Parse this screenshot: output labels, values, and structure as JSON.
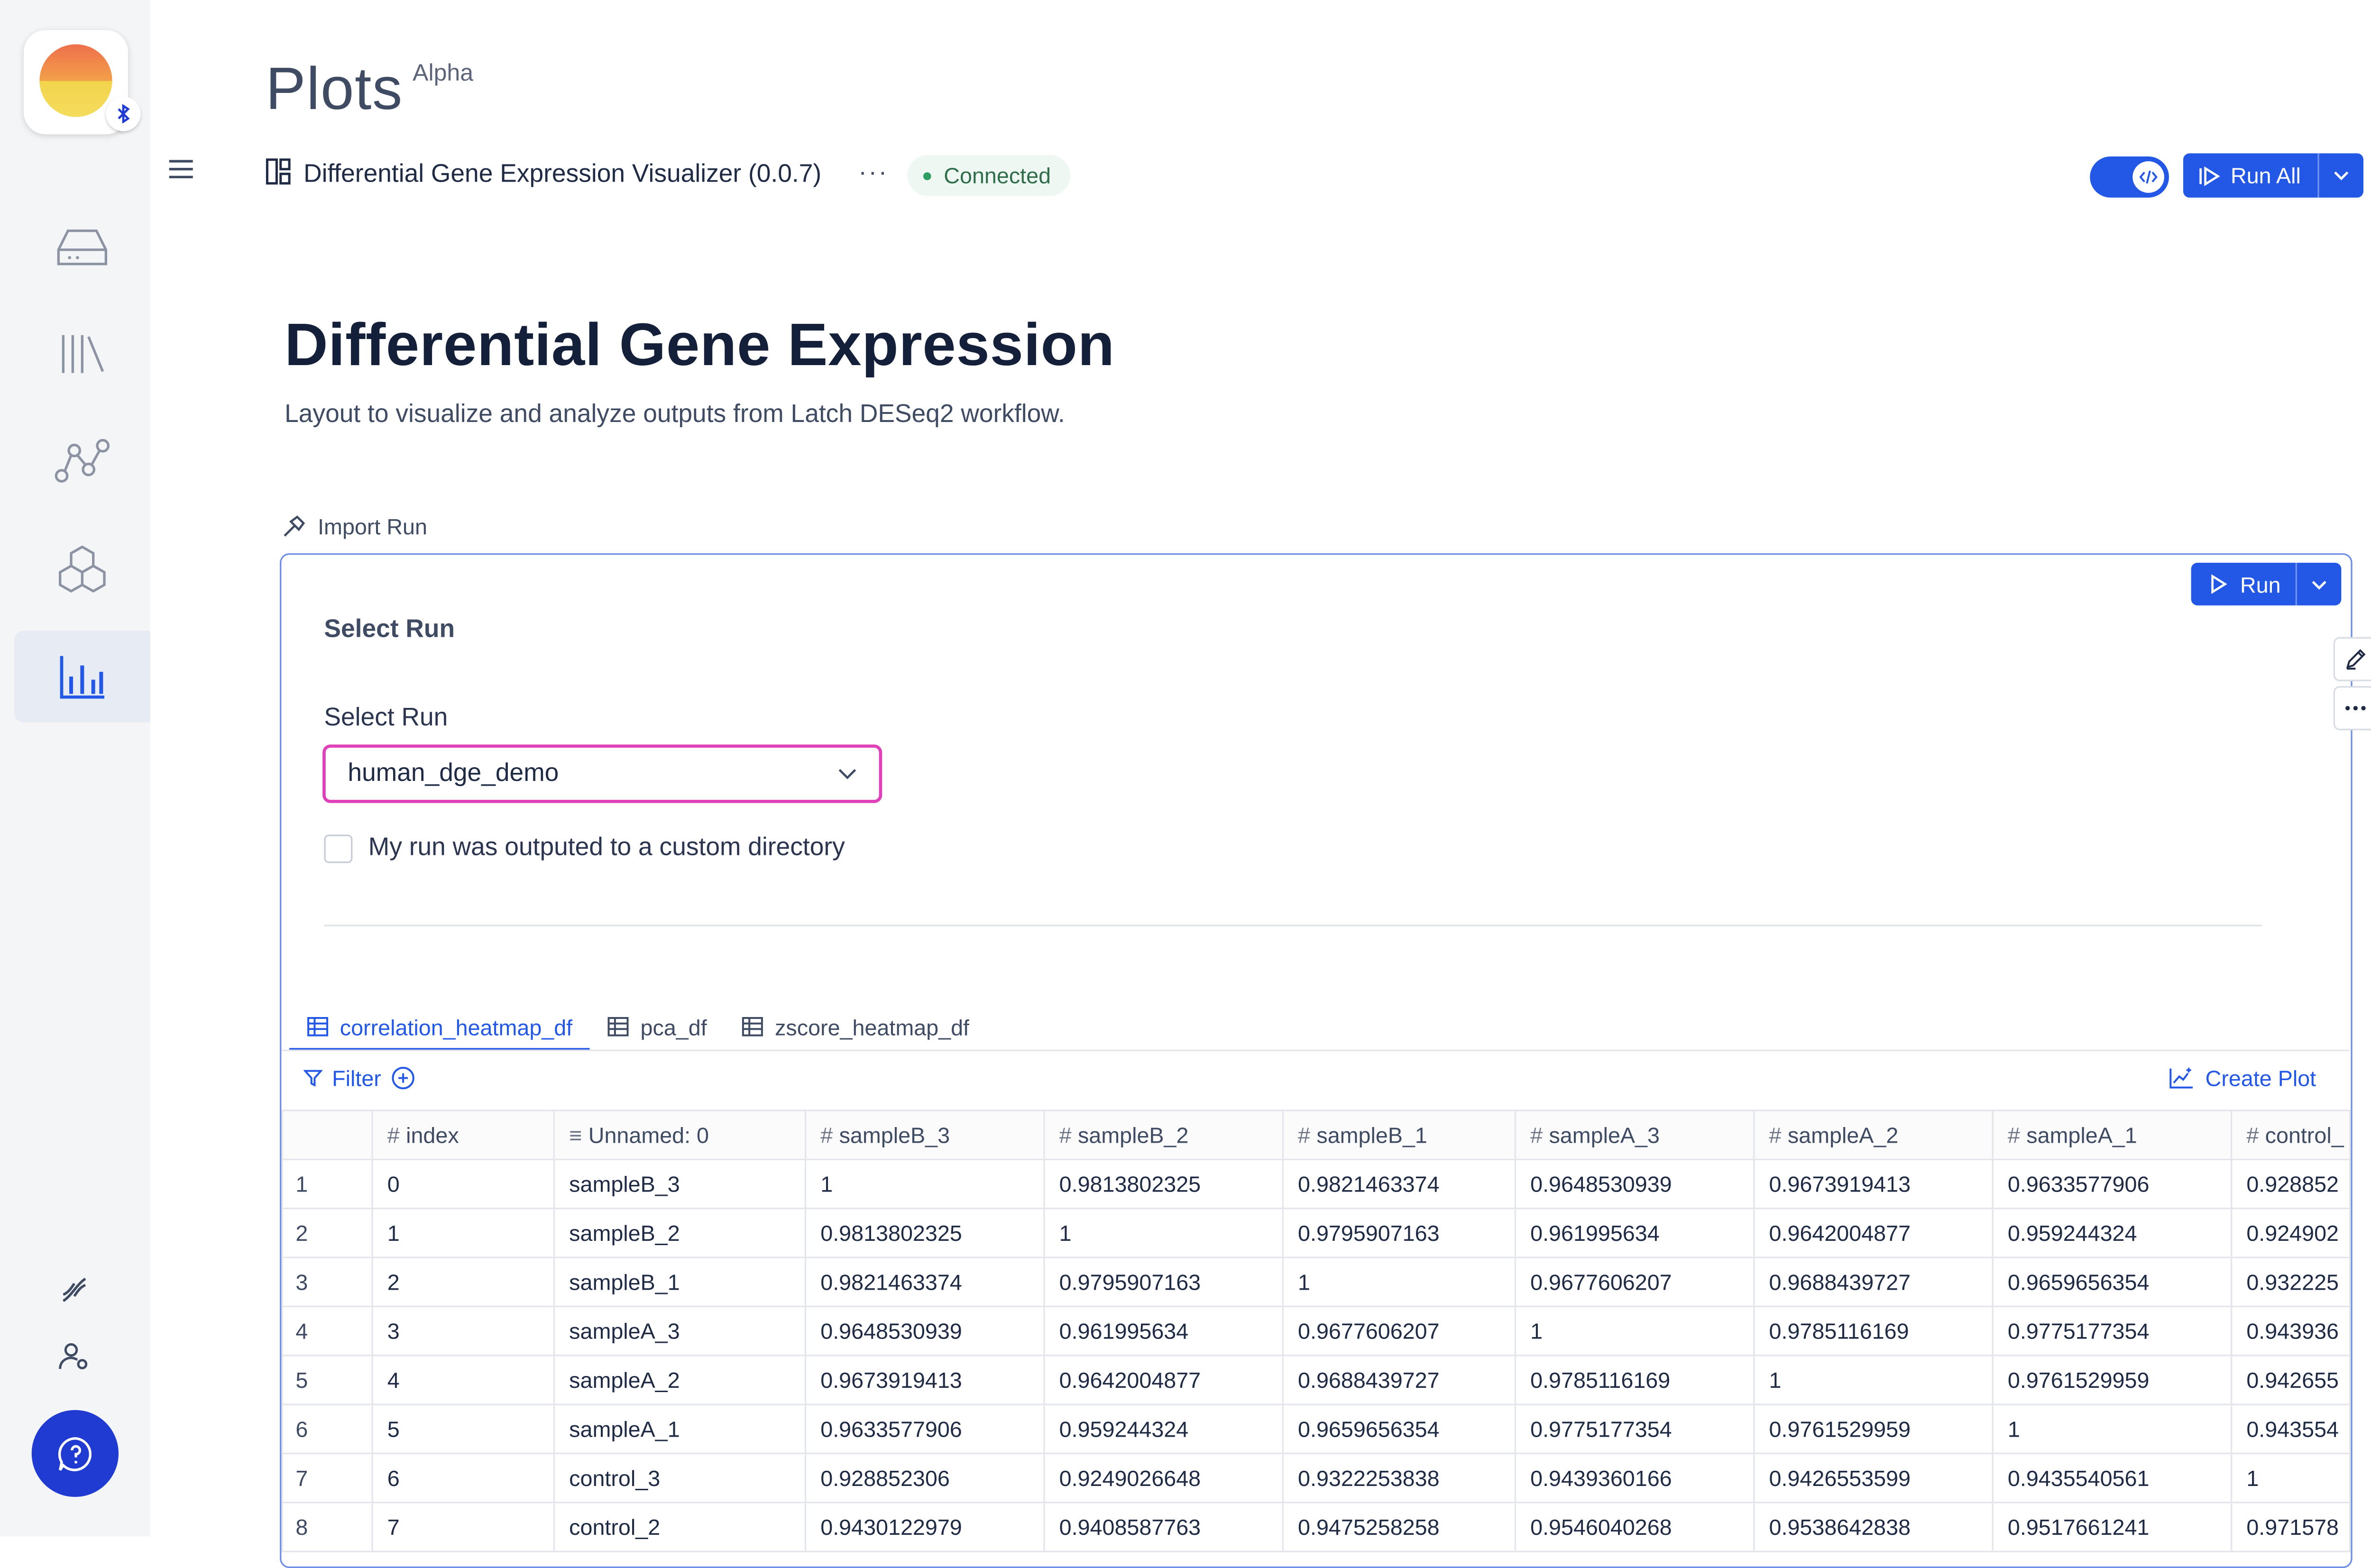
{
  "app": {
    "page_title": "Plots",
    "page_badge": "Alpha"
  },
  "header": {
    "layout_name": "Differential Gene Expression Visualizer (0.0.7)",
    "more_label": "···",
    "status": "Connected",
    "run_all_label": "Run All"
  },
  "sidebar": {
    "items": [
      {
        "icon": "storage-drive-icon"
      },
      {
        "icon": "library-icon"
      },
      {
        "icon": "workflow-graph-icon"
      },
      {
        "icon": "hexagon-cluster-icon"
      },
      {
        "icon": "bar-chart-icon",
        "active": true
      }
    ],
    "bottom": [
      {
        "icon": "dna-icon"
      },
      {
        "icon": "user-settings-icon"
      },
      {
        "icon": "help-chat-icon"
      }
    ]
  },
  "content": {
    "heading": "Differential Gene Expression",
    "description": "Layout to visualize and analyze outputs from Latch DESeq2 workflow.",
    "import_label": "Import Run"
  },
  "cell": {
    "run_label": "Run",
    "section_title": "Select Run",
    "select_label": "Select Run",
    "select_value": "human_dge_demo",
    "checkbox_label": "My run was outputed to a custom directory",
    "checkbox_checked": false,
    "tabs": [
      "correlation_heatmap_df",
      "pca_df",
      "zscore_heatmap_df"
    ],
    "active_tab": "correlation_heatmap_df",
    "filter_label": "Filter",
    "create_plot_label": "Create Plot"
  },
  "table": {
    "columns": [
      {
        "icon": "#",
        "label": "index"
      },
      {
        "icon": "≡",
        "label": "Unnamed: 0"
      },
      {
        "icon": "#",
        "label": "sampleB_3"
      },
      {
        "icon": "#",
        "label": "sampleB_2"
      },
      {
        "icon": "#",
        "label": "sampleB_1"
      },
      {
        "icon": "#",
        "label": "sampleA_3"
      },
      {
        "icon": "#",
        "label": "sampleA_2"
      },
      {
        "icon": "#",
        "label": "sampleA_1"
      },
      {
        "icon": "#",
        "label": "control_"
      }
    ],
    "rows": [
      [
        "1",
        "0",
        "sampleB_3",
        "1",
        "0.9813802325",
        "0.9821463374",
        "0.9648530939",
        "0.9673919413",
        "0.9633577906",
        "0.928852"
      ],
      [
        "2",
        "1",
        "sampleB_2",
        "0.9813802325",
        "1",
        "0.9795907163",
        "0.961995634",
        "0.9642004877",
        "0.959244324",
        "0.924902"
      ],
      [
        "3",
        "2",
        "sampleB_1",
        "0.9821463374",
        "0.9795907163",
        "1",
        "0.9677606207",
        "0.9688439727",
        "0.9659656354",
        "0.932225"
      ],
      [
        "4",
        "3",
        "sampleA_3",
        "0.9648530939",
        "0.961995634",
        "0.9677606207",
        "1",
        "0.9785116169",
        "0.9775177354",
        "0.943936"
      ],
      [
        "5",
        "4",
        "sampleA_2",
        "0.9673919413",
        "0.9642004877",
        "0.9688439727",
        "0.9785116169",
        "1",
        "0.9761529959",
        "0.942655"
      ],
      [
        "6",
        "5",
        "sampleA_1",
        "0.9633577906",
        "0.959244324",
        "0.9659656354",
        "0.9775177354",
        "0.9761529959",
        "1",
        "0.943554"
      ],
      [
        "7",
        "6",
        "control_3",
        "0.928852306",
        "0.9249026648",
        "0.9322253838",
        "0.9439360166",
        "0.9426553599",
        "0.9435540561",
        "1"
      ],
      [
        "8",
        "7",
        "control_2",
        "0.9430122979",
        "0.9408587763",
        "0.9475258258",
        "0.9546040268",
        "0.9538642838",
        "0.9517661241",
        "0.971578"
      ]
    ]
  }
}
